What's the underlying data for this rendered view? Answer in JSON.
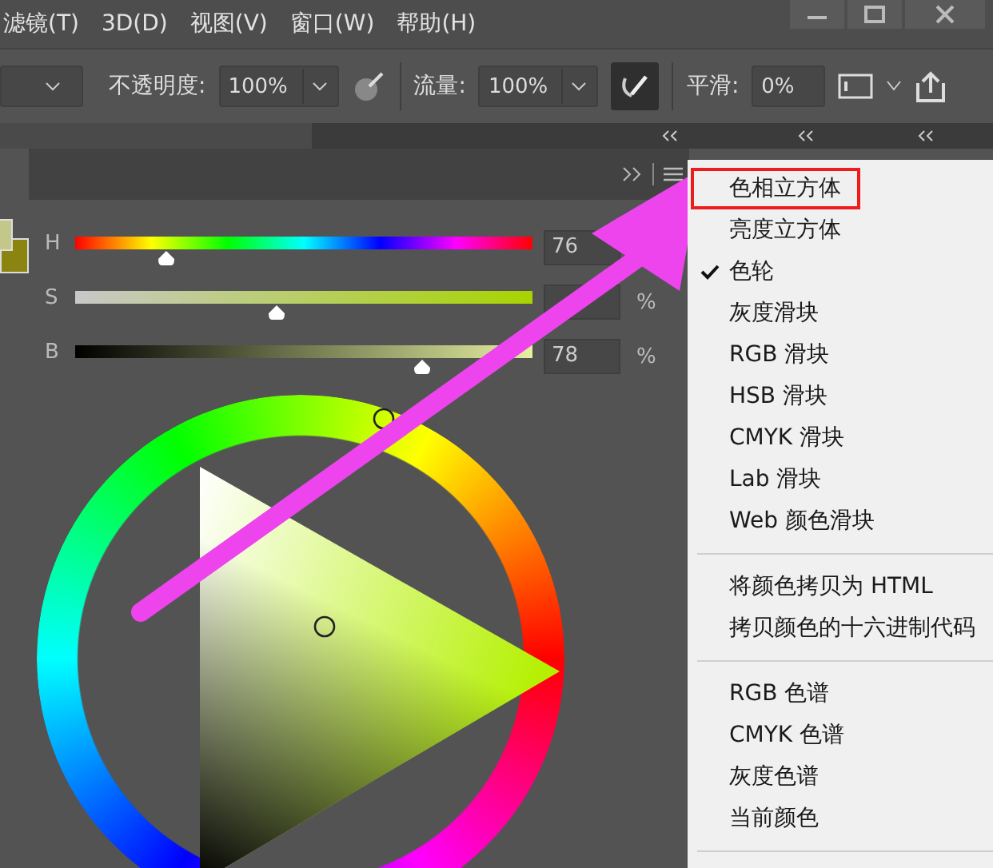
{
  "menu_bar": [
    "滤镜(T)",
    "3D(D)",
    "视图(V)",
    "窗口(W)",
    "帮助(H)"
  ],
  "toolbar": {
    "opacity_label": "不透明度:",
    "opacity_value": "100%",
    "flow_label": "流量:",
    "flow_value": "100%",
    "airbrush_on": true,
    "smoothing_label": "平滑:",
    "smoothing_value": "0%"
  },
  "color_panel": {
    "sliders": [
      {
        "label": "H",
        "kind": "hue",
        "level": 0.2,
        "value": "76"
      },
      {
        "label": "S",
        "kind": "saturation",
        "level": 0.44,
        "unit": "%"
      },
      {
        "label": "B",
        "kind": "brightness",
        "level": 0.76,
        "value": "78",
        "unit": "%"
      }
    ]
  },
  "flyout_menu": [
    {
      "kind": "item",
      "label": "色相立方体",
      "checked": false,
      "outlined": true
    },
    {
      "kind": "item",
      "label": "亮度立方体",
      "checked": false,
      "outlined": false
    },
    {
      "kind": "item",
      "label": "色轮",
      "checked": true,
      "outlined": false
    },
    {
      "kind": "item",
      "label": "灰度滑块",
      "checked": false,
      "outlined": false
    },
    {
      "kind": "item",
      "label": "RGB 滑块",
      "checked": false,
      "outlined": false
    },
    {
      "kind": "item",
      "label": "HSB 滑块",
      "checked": false,
      "outlined": false
    },
    {
      "kind": "item",
      "label": "CMYK 滑块",
      "checked": false,
      "outlined": false
    },
    {
      "kind": "item",
      "label": "Lab 滑块",
      "checked": false,
      "outlined": false
    },
    {
      "kind": "item",
      "label": "Web 颜色滑块",
      "checked": false,
      "outlined": false
    },
    {
      "kind": "separator"
    },
    {
      "kind": "item",
      "label": "将颜色拷贝为 HTML",
      "checked": false,
      "outlined": false
    },
    {
      "kind": "item",
      "label": "拷贝颜色的十六进制代码",
      "checked": false,
      "outlined": false
    },
    {
      "kind": "separator"
    },
    {
      "kind": "item",
      "label": "RGB 色谱",
      "checked": false,
      "outlined": false
    },
    {
      "kind": "item",
      "label": "CMYK 色谱",
      "checked": false,
      "outlined": false
    },
    {
      "kind": "item",
      "label": "灰度色谱",
      "checked": false,
      "outlined": false
    },
    {
      "kind": "item",
      "label": "当前颜色",
      "checked": false,
      "outlined": false
    },
    {
      "kind": "separator"
    }
  ]
}
